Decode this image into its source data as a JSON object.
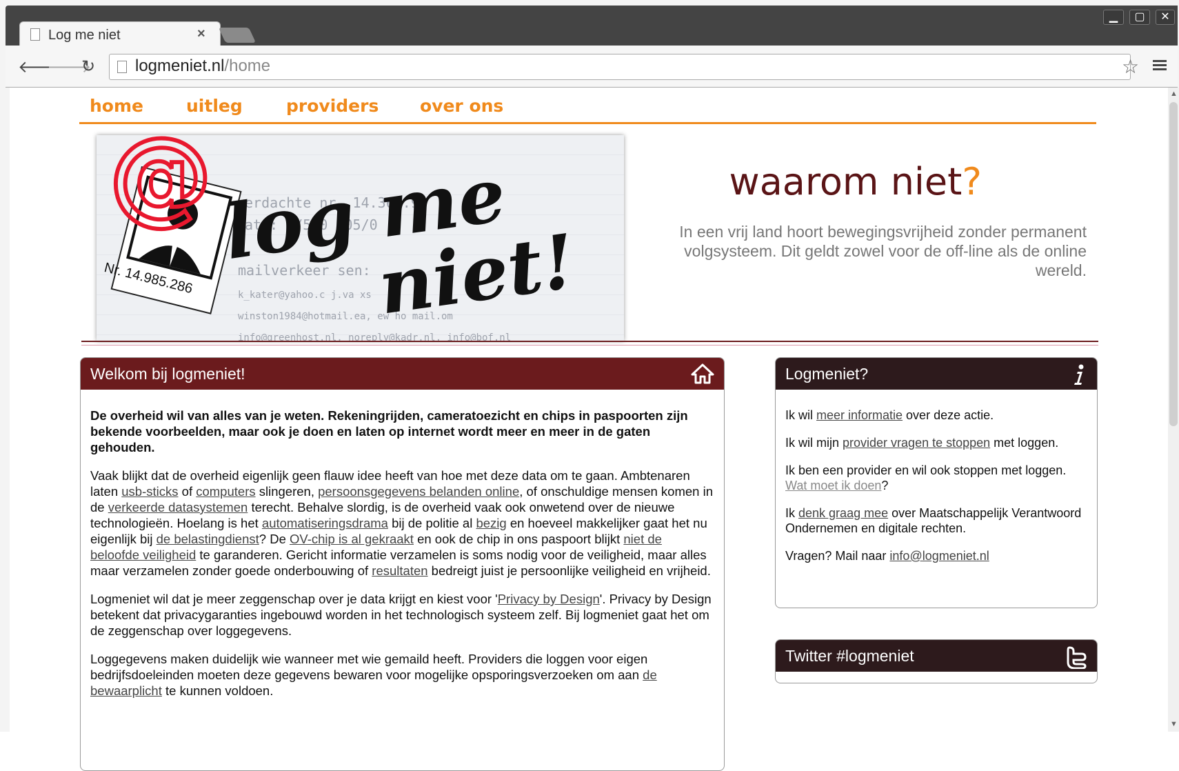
{
  "browser": {
    "tab_title": "Log me niet",
    "tab_close": "×",
    "url_host": "logmeniet.nl",
    "url_path": "/home",
    "back": "🡐",
    "forward": "🡒",
    "reload": "↻",
    "star": "☆",
    "win_min": "▁",
    "win_max": "▢",
    "win_close": "✕"
  },
  "nav": {
    "items": [
      "home",
      "uitleg",
      "providers",
      "over ons"
    ]
  },
  "banner": {
    "logo_text_1": "log me",
    "logo_text_2": "niet!",
    "at_sign": "@",
    "badge_number": "Nr. 14.985.286",
    "bg_line1": "erdachte nr. 14.365.9",
    "bg_line2": "ata: 0/5/0 /05/0",
    "bg_line3": "mailverkeer sen:",
    "bg_line4": "k_kater@yahoo.c j.va xs",
    "bg_line5": "winston1984@hotmail.ea, ew ho mail.om",
    "bg_line6": "info@greenhost.nl, noreply@kadr.nl, info@bof.nl"
  },
  "tagline": {
    "heading": "waarom niet",
    "qmark": "?",
    "sub": "In een vrij land hoort bewegingsvrijheid zonder permanent volgsysteem. Dit geldt zowel voor de off-line als de online wereld."
  },
  "main_panel": {
    "title": "Welkom bij logmeniet!",
    "icon": "home-icon",
    "intro": "De overheid wil van alles van je weten. Rekeningrijden, cameratoezicht en chips in paspoorten zijn bekende voorbeelden, maar ook je doen en laten op internet wordt meer en meer in de gaten gehouden.",
    "p2": {
      "t1": "Vaak blijkt dat de overheid eigenlijk geen flauw idee heeft van hoe met deze data om te gaan. Ambtenaren laten ",
      "l1": "usb-sticks",
      "t2": " of ",
      "l2": "computers",
      "t3": " slingeren, ",
      "l3": "persoonsgegevens belanden online",
      "t4": ", of onschuldige mensen komen in de ",
      "l4": "verkeerde datasystemen",
      "t5": " terecht. Behalve slordig, is de overheid vaak ook onwetend over de nieuwe technologieën. Hoelang is het ",
      "l5": "automatiseringsdrama",
      "t6": " bij de politie al ",
      "l6": "bezig",
      "t7": " en hoeveel makkelijker gaat het nu eigenlijk bij ",
      "l7": "de belastingdienst",
      "t8": "?  De ",
      "l8": "OV-chip is al gekraakt",
      "t9": " en ook de chip in ons paspoort blijkt ",
      "l9": "niet de beloofde veiligheid",
      "t10": " te garanderen. Gericht informatie verzamelen is soms nodig voor de veiligheid, maar alles maar verzamelen zonder goede onderbouwing of ",
      "l10": "resultaten",
      "t11": " bedreigt juist je persoonlijke veiligheid en vrijheid."
    },
    "p3": {
      "t1": "Logmeniet wil dat je meer zeggenschap over je data krijgt en kiest voor '",
      "l1": "Privacy by Design",
      "t2": "'. Privacy by Design betekent dat privacygaranties ingebouwd worden in het technologisch systeem zelf. Bij logmeniet gaat het om de zeggenschap over loggegevens."
    },
    "p4": {
      "t1": "Loggegevens maken duidelijk wie wanneer met wie gemaild heeft. Providers die loggen voor eigen bedrijfsdoeleinden moeten deze gegevens bewaren voor mogelijke opsporingsverzoeken om aan ",
      "l1": "de bewaarplicht",
      "t2": " te kunnen voldoen."
    }
  },
  "side_panel": {
    "title": "Logmeniet?",
    "icon": "info-icon",
    "s1": {
      "t1": "Ik wil ",
      "l1": "meer informatie",
      "t2": " over deze actie."
    },
    "s2": {
      "t1": "Ik wil mijn ",
      "l1": "provider vragen te stoppen",
      "t2": " met loggen."
    },
    "s3": {
      "t1": "Ik ben een provider en wil ook stoppen met loggen. ",
      "l1": "Wat moet ik doen",
      "t2": "?"
    },
    "s4": {
      "t1": "Ik ",
      "l1": "denk graag mee",
      "t2": " over Maatschappelijk Verantwoord Ondernemen en digitale rechten."
    },
    "s5": {
      "t1": "Vragen? Mail naar ",
      "l1": "info@logmeniet.nl"
    }
  },
  "twitter_panel": {
    "title": "Twitter #logmeniet",
    "icon": "twitter-icon"
  }
}
